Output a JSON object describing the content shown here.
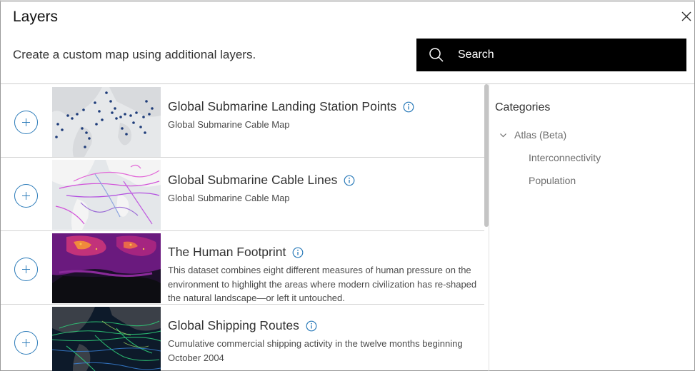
{
  "dialog": {
    "title": "Layers",
    "subtitle": "Create a custom map using additional layers."
  },
  "search": {
    "placeholder": "Search",
    "icon": "search-icon"
  },
  "layers": [
    {
      "title": "Global Submarine Landing Station Points",
      "subtitle": "Global Submarine Cable Map"
    },
    {
      "title": "Global Submarine Cable Lines",
      "subtitle": "Global Submarine Cable Map"
    },
    {
      "title": "The Human Footprint",
      "description": "This dataset combines eight different measures of human pressure on the environment to highlight the areas where modern civilization has re-shaped the natural landscape—or left it untouched."
    },
    {
      "title": "Global Shipping Routes",
      "description": "Cumulative commercial shipping activity in the twelve months beginning October 2004"
    }
  ],
  "categories": {
    "title": "Categories",
    "group": "Atlas (Beta)",
    "items": [
      "Interconnectivity",
      "Population"
    ]
  },
  "colors": {
    "accent": "#2b7bb9",
    "search_bg": "#000000",
    "text": "#323232"
  }
}
